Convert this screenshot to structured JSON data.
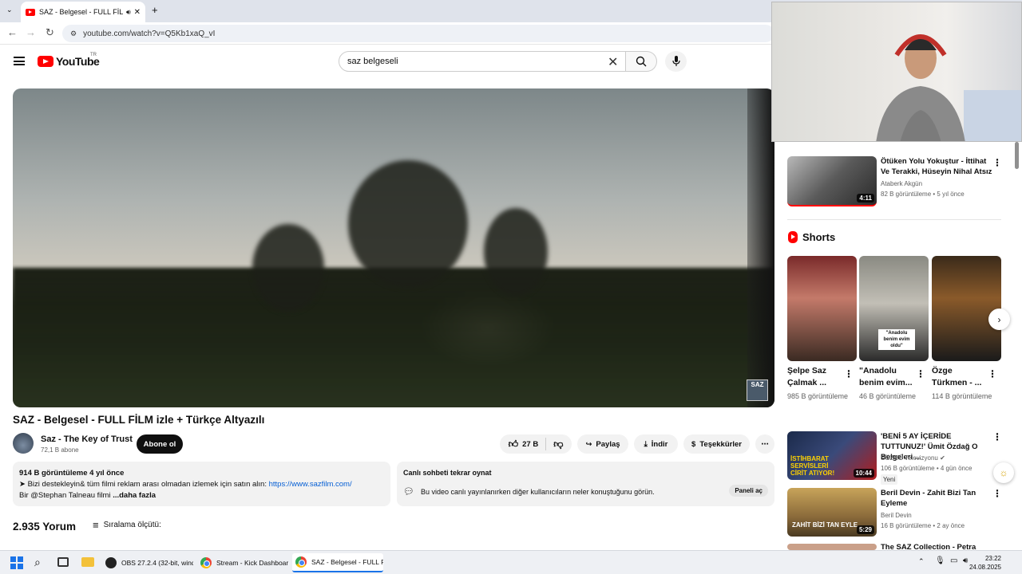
{
  "browser": {
    "tab_title": "SAZ - Belgesel - FULL FİLM",
    "url": "youtube.com/watch?v=Q5Kb1xaQ_vI"
  },
  "header": {
    "logo_text": "YouTube",
    "country_code": "TR",
    "search_value": "saz belgeseli"
  },
  "video": {
    "title": "SAZ - Belgesel - FULL FİLM izle + Türkçe Altyazılı",
    "watermark": "SAZ"
  },
  "channel": {
    "name": "Saz - The Key of Trust",
    "subscribers": "72,1 B abone",
    "subscribe_label": "Abone ol"
  },
  "actions": {
    "likes": "27 B",
    "share": "Paylaş",
    "download": "İndir",
    "thanks": "Teşekkürler"
  },
  "description": {
    "stats": "914 B görüntüleme  4 yıl önce",
    "line1_prefix": "➤ Bizi destekleyin& tüm filmi reklam arası olmadan izlemek için satın alın: ",
    "line1_link": "https://www.sazfilm.com/",
    "line2": "Bir @Stephan Talneau filmi",
    "more": "...daha fazla"
  },
  "chat": {
    "title": "Canlı sohbeti tekrar oynat",
    "text": "Bu video canlı yayınlanırken diğer kullanıcıların neler konuştuğunu görün.",
    "open_label": "Paneli aç"
  },
  "comments": {
    "count": "2.935 Yorum",
    "sort_label": "Sıralama ölçütü:"
  },
  "sidebar": {
    "top_video": {
      "title": "Ötüken Yolu Yokuştur - İttihat Ve Terakki, Hüseyin Nihal Atsız",
      "channel": "Ataberk Akgün",
      "meta": "82 B görüntüleme  •  5 yıl önce",
      "duration": "4:11"
    },
    "shorts_title": "Shorts",
    "shorts": [
      {
        "title": "Şelpe Saz Çalmak ...",
        "views": "985 B görüntüleme"
      },
      {
        "title": "\"Anadolu benim evim...",
        "views": "46 B görüntüleme",
        "overlay": "\"Anadolu benim evim oldu\""
      },
      {
        "title": "Özge Türkmen - ...",
        "views": "114 B görüntüleme"
      }
    ],
    "videos": [
      {
        "title": "'BENİ 5 AY İÇERİDE TUTTUNUZ!' Ümit Özdağ O Belgeleri ...",
        "channel": "SÖZCÜ Televizyonu",
        "meta": "106 B görüntüleme  •  4 gün önce",
        "badge": "Yeni",
        "duration": "10:44",
        "thumb_text": "İSTİHBARAT SERVİSLERİ CİRİT ATIYOR!"
      },
      {
        "title": "Beril Devin - Zahit Bizi Tan Eyleme",
        "channel": "Beril Devin",
        "meta": "16 B görüntüleme  •  2 ay önce",
        "duration": "5:29",
        "thumb_text": "ZAHİT BİZİ TAN EYLE"
      },
      {
        "title": "The SAZ Collection - Petra",
        "channel": "",
        "meta": ""
      }
    ]
  },
  "taskbar": {
    "apps": [
      {
        "label": "OBS 27.2.4 (32-bit, wind"
      },
      {
        "label": "Stream - Kick Dashboard"
      },
      {
        "label": "SAZ - Belgesel - FULL Fi"
      }
    ],
    "time": "23:22",
    "date": "24.08.2025"
  }
}
